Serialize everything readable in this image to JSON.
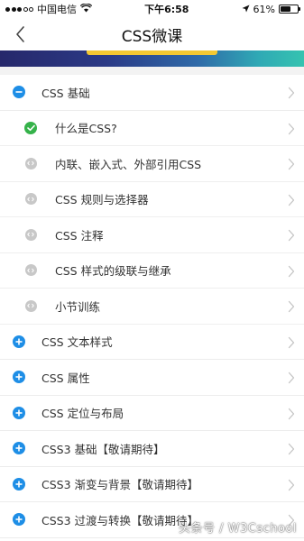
{
  "status_bar": {
    "carrier": "中国电信",
    "time": "下午6:58",
    "battery_percent": "61%",
    "battery_level": 0.61
  },
  "nav": {
    "title": "CSS微课"
  },
  "chapters": [
    {
      "label": "CSS 基础",
      "state": "expanded",
      "lessons": [
        {
          "label": "什么是CSS?",
          "status": "completed"
        },
        {
          "label": "内联、嵌入式、外部引用CSS",
          "status": "locked"
        },
        {
          "label": "CSS 规则与选择器",
          "status": "locked"
        },
        {
          "label": "CSS 注释",
          "status": "locked"
        },
        {
          "label": "CSS 样式的级联与继承",
          "status": "locked"
        },
        {
          "label": "小节训练",
          "status": "locked"
        }
      ]
    },
    {
      "label": "CSS 文本样式",
      "state": "collapsed"
    },
    {
      "label": "CSS 属性",
      "state": "collapsed"
    },
    {
      "label": "CSS 定位与布局",
      "state": "collapsed"
    },
    {
      "label": "CSS3 基础【敬请期待】",
      "state": "collapsed"
    },
    {
      "label": "CSS3 渐变与背景【敬请期待】",
      "state": "collapsed"
    },
    {
      "label": "CSS3 过渡与转换【敬请期待】",
      "state": "collapsed"
    }
  ],
  "watermark": "头条号 / W3Cschool",
  "colors": {
    "accent_blue": "#1e8ee6",
    "done_green": "#35b24a",
    "locked_gray": "#c8c8c8",
    "banner_tab": "#f4c832"
  }
}
